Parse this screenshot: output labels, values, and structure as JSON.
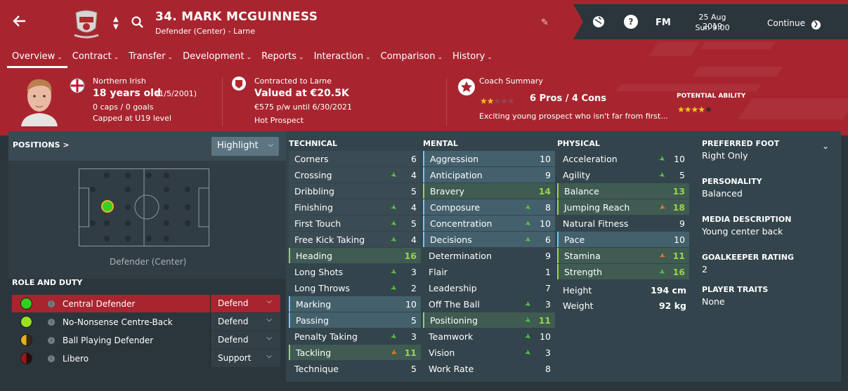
{
  "header": {
    "title": "34. MARK MCGUINNESS",
    "subtitle": "Defender (Center) - Larne",
    "date": "25 Aug 2019",
    "time": "Sun 9:00",
    "fm_label": "FM",
    "continue_label": "Continue",
    "help_label": "?"
  },
  "tabs": [
    {
      "label": "Overview"
    },
    {
      "label": "Contract"
    },
    {
      "label": "Transfer"
    },
    {
      "label": "Development"
    },
    {
      "label": "Reports"
    },
    {
      "label": "Interaction"
    },
    {
      "label": "Comparison"
    },
    {
      "label": "History"
    }
  ],
  "summary": {
    "nationality": "Northern Irish",
    "age": "18 years old",
    "dob": "(1/5/2001)",
    "caps": "0 caps / 0 goals",
    "capped": "Capped at U19 level",
    "contract_to": "Contracted to Larne",
    "value": "Valued at €20.5K",
    "wage": "€575 p/w until 6/30/2021",
    "status": "Hot Prospect",
    "coach_title": "Coach Summary",
    "pros_cons": "6 Pros / 4 Cons",
    "coach_text": "Exciting young prospect who isn't far from first...",
    "potential_label": "POTENTIAL ABILITY",
    "coach_stars": 2,
    "potential_stars": 3.5
  },
  "positions": {
    "title": "POSITIONS",
    "arrow": ">",
    "highlight": "Highlight",
    "position_label": "Defender (Center)"
  },
  "role": {
    "title": "ROLE AND DUTY",
    "rows": [
      {
        "name": "Central Defender",
        "duty": "Defend",
        "dot": "#2fd11e"
      },
      {
        "name": "No-Nonsense Centre-Back",
        "duty": "Defend",
        "dot": "#9be021"
      },
      {
        "name": "Ball Playing Defender",
        "duty": "Defend",
        "dot": "#e0b21f"
      },
      {
        "name": "Libero",
        "duty": "Support",
        "dot": "#9a1717"
      }
    ]
  },
  "technical": {
    "title": "TECHNICAL",
    "rows": [
      {
        "name": "Corners",
        "value": "6",
        "arrow": ""
      },
      {
        "name": "Crossing",
        "value": "4",
        "arrow": "up"
      },
      {
        "name": "Dribbling",
        "value": "5",
        "arrow": ""
      },
      {
        "name": "Finishing",
        "value": "4",
        "arrow": "up"
      },
      {
        "name": "First Touch",
        "value": "5",
        "arrow": "up"
      },
      {
        "name": "Free Kick Taking",
        "value": "4",
        "arrow": "up"
      },
      {
        "name": "Heading",
        "value": "16",
        "arrow": ""
      },
      {
        "name": "Long Shots",
        "value": "3",
        "arrow": "up"
      },
      {
        "name": "Long Throws",
        "value": "2",
        "arrow": "up"
      },
      {
        "name": "Marking",
        "value": "10",
        "arrow": ""
      },
      {
        "name": "Passing",
        "value": "5",
        "arrow": ""
      },
      {
        "name": "Penalty Taking",
        "value": "3",
        "arrow": "up"
      },
      {
        "name": "Tackling",
        "value": "11",
        "arrow": "down"
      },
      {
        "name": "Technique",
        "value": "5",
        "arrow": ""
      }
    ]
  },
  "mental": {
    "title": "MENTAL",
    "rows": [
      {
        "name": "Aggression",
        "value": "10",
        "arrow": ""
      },
      {
        "name": "Anticipation",
        "value": "9",
        "arrow": ""
      },
      {
        "name": "Bravery",
        "value": "14",
        "arrow": ""
      },
      {
        "name": "Composure",
        "value": "8",
        "arrow": "up"
      },
      {
        "name": "Concentration",
        "value": "10",
        "arrow": "up"
      },
      {
        "name": "Decisions",
        "value": "6",
        "arrow": "up"
      },
      {
        "name": "Determination",
        "value": "9",
        "arrow": ""
      },
      {
        "name": "Flair",
        "value": "1",
        "arrow": ""
      },
      {
        "name": "Leadership",
        "value": "7",
        "arrow": ""
      },
      {
        "name": "Off The Ball",
        "value": "3",
        "arrow": "up"
      },
      {
        "name": "Positioning",
        "value": "11",
        "arrow": "up"
      },
      {
        "name": "Teamwork",
        "value": "10",
        "arrow": "up"
      },
      {
        "name": "Vision",
        "value": "3",
        "arrow": "up"
      },
      {
        "name": "Work Rate",
        "value": "8",
        "arrow": ""
      }
    ]
  },
  "physical": {
    "title": "PHYSICAL",
    "rows": [
      {
        "name": "Acceleration",
        "value": "10",
        "arrow": "up"
      },
      {
        "name": "Agility",
        "value": "5",
        "arrow": "up"
      },
      {
        "name": "Balance",
        "value": "13",
        "arrow": ""
      },
      {
        "name": "Jumping Reach",
        "value": "18",
        "arrow": "down"
      },
      {
        "name": "Natural Fitness",
        "value": "9",
        "arrow": ""
      },
      {
        "name": "Pace",
        "value": "10",
        "arrow": ""
      },
      {
        "name": "Stamina",
        "value": "11",
        "arrow": "down"
      },
      {
        "name": "Strength",
        "value": "16",
        "arrow": "up"
      }
    ],
    "height_label": "Height",
    "height": "194 cm",
    "weight_label": "Weight",
    "weight": "92 kg"
  },
  "info": [
    {
      "label": "PREFERRED FOOT",
      "value": "Right Only"
    },
    {
      "label": "PERSONALITY",
      "value": "Balanced"
    },
    {
      "label": "MEDIA DESCRIPTION",
      "value": "Young center back"
    },
    {
      "label": "GOALKEEPER RATING",
      "value": "2"
    },
    {
      "label": "PLAYER TRAITS",
      "value": "None"
    }
  ],
  "colors": {
    "header_red": "#a8252f",
    "good_value": "#9bd24a",
    "arrow_up": "#56c146",
    "arrow_down": "#e07a2a"
  }
}
